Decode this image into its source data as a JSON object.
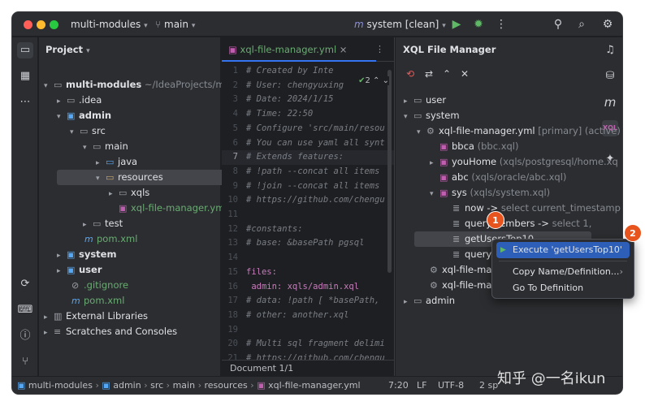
{
  "titlebar": {
    "project_name": "multi-modules",
    "branch": "main",
    "run_config": "system [clean]"
  },
  "project_panel": {
    "title": "Project",
    "tree": [
      {
        "label": "multi-modules",
        "extra": "~/IdeaProjects/multi-m"
      },
      {
        "label": ".idea"
      },
      {
        "label": "admin"
      },
      {
        "label": "src"
      },
      {
        "label": "main"
      },
      {
        "label": "java"
      },
      {
        "label": "resources"
      },
      {
        "label": "xqls"
      },
      {
        "label": "xql-file-manager.yml"
      },
      {
        "label": "test"
      },
      {
        "label": "pom.xml"
      },
      {
        "label": "system"
      },
      {
        "label": "user"
      },
      {
        "label": ".gitignore"
      },
      {
        "label": "pom.xml"
      },
      {
        "label": "External Libraries"
      },
      {
        "label": "Scratches and Consoles"
      }
    ]
  },
  "editor": {
    "tab_label": "xql-file-manager.yml",
    "inspection_count": "2",
    "breadcrumb": "Document 1/1",
    "lines": [
      {
        "n": "1",
        "t": "# Created by Inte",
        "c": "cm"
      },
      {
        "n": "2",
        "t": "# User: chengyuxing",
        "c": "cm"
      },
      {
        "n": "3",
        "t": "# Date: 2024/1/15",
        "c": "cm"
      },
      {
        "n": "4",
        "t": "# Time: 22:50",
        "c": "cm"
      },
      {
        "n": "5",
        "t": "# Configure 'src/main/resou",
        "c": "cm"
      },
      {
        "n": "6",
        "t": "# You can use yaml all synt",
        "c": "cm"
      },
      {
        "n": "7",
        "t": "# Extends features:",
        "c": "cm"
      },
      {
        "n": "8",
        "t": "# !path --concat all items",
        "c": "cm"
      },
      {
        "n": "9",
        "t": "# !join --concat all items",
        "c": "cm"
      },
      {
        "n": "10",
        "t": "# https://github.com/chengu",
        "c": "cm"
      },
      {
        "n": "11",
        "t": "",
        "c": "tx"
      },
      {
        "n": "12",
        "t": "#constants:",
        "c": "cm"
      },
      {
        "n": "13",
        "t": "#  base: &basePath pgsql",
        "c": "cm"
      },
      {
        "n": "14",
        "t": "",
        "c": "tx"
      },
      {
        "n": "15",
        "t": "files:",
        "c": "ky"
      },
      {
        "n": "16",
        "t": "  admin: xqls/admin.xql",
        "c": "ky"
      },
      {
        "n": "17",
        "t": "#  data: !path [ *basePath,",
        "c": "cm"
      },
      {
        "n": "18",
        "t": "#  other: another.xql",
        "c": "cm"
      },
      {
        "n": "19",
        "t": "",
        "c": "tx"
      },
      {
        "n": "20",
        "t": "# Multi sql fragment delimi",
        "c": "cm"
      },
      {
        "n": "21",
        "t": "# https://github.com/chengu",
        "c": "cm"
      }
    ]
  },
  "xql_panel": {
    "title": "XQL File Manager",
    "tree": [
      {
        "label": "user",
        "extra": ""
      },
      {
        "label": "system",
        "extra": ""
      },
      {
        "label": "xql-file-manager.yml",
        "extra": "[primary] (active)"
      },
      {
        "label": "bbca",
        "extra": "(bbc.xql)"
      },
      {
        "label": "youHome",
        "extra": "(xqls/postgresql/home.xq"
      },
      {
        "label": "abc",
        "extra": "(xqls/oracle/abc.xql)"
      },
      {
        "label": "sys",
        "extra": "(xqls/system.xql)"
      },
      {
        "label": "now ->",
        "extra": "select current_timestamp"
      },
      {
        "label": "queryMembers ->",
        "extra": "select 1,"
      },
      {
        "label": "getUsersTop10",
        "extra": ""
      },
      {
        "label": "queryU",
        "extra": ""
      },
      {
        "label": "xql-file-mana",
        "extra": ""
      },
      {
        "label": "xql-file-mana",
        "extra": ""
      },
      {
        "label": "admin",
        "extra": ""
      }
    ]
  },
  "context_menu": {
    "items": [
      {
        "label": "Execute 'getUsersTop10'"
      },
      {
        "label": "Copy Name/Definition..."
      },
      {
        "label": "Go To Definition"
      }
    ]
  },
  "badges": {
    "one": "1",
    "two": "2"
  },
  "statusbar": {
    "path": [
      "multi-modules",
      "admin",
      "src",
      "main",
      "resources",
      "xql-file-manager.yml"
    ],
    "position": "7:20",
    "line_sep": "LF",
    "encoding": "UTF-8",
    "indent": "2 sp"
  },
  "watermark": "知乎 @一名ikun",
  "colors": {
    "accent": "#3574f0",
    "badge": "#e8541e",
    "background": "#1e1f22",
    "panel": "#2b2d30"
  }
}
